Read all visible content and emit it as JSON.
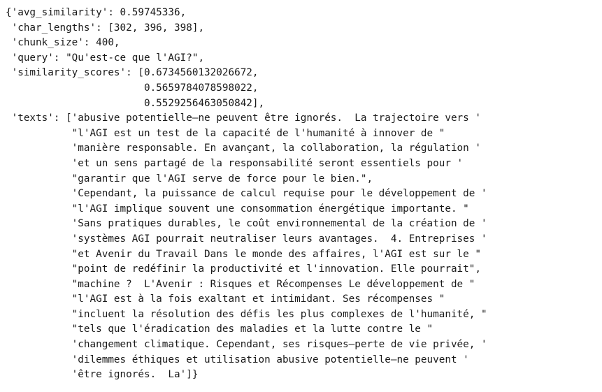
{
  "output": {
    "lines": [
      "{'avg_similarity': 0.59745336,",
      " 'char_lengths': [302, 396, 398],",
      " 'chunk_size': 400,",
      " 'query': \"Qu'est-ce que l'AGI?\",",
      " 'similarity_scores': [0.6734560132026672,",
      "                       0.5659784078598022,",
      "                       0.5529256463050842],",
      " 'texts': ['abusive potentielle—ne peuvent être ignorés.  La trajectoire vers '",
      "           \"l'AGI est un test de la capacité de l'humanité à innover de \"",
      "           'manière responsable. En avançant, la collaboration, la régulation '",
      "           'et un sens partagé de la responsabilité seront essentiels pour '",
      "           \"garantir que l'AGI serve de force pour le bien.\",",
      "           'Cependant, la puissance de calcul requise pour le développement de '",
      "           \"l'AGI implique souvent une consommation énergétique importante. \"",
      "           'Sans pratiques durables, le coût environnemental de la création de '",
      "           'systèmes AGI pourrait neutraliser leurs avantages.  4. Entreprises '",
      "           \"et Avenir du Travail Dans le monde des affaires, l'AGI est sur le \"",
      "           \"point de redéfinir la productivité et l'innovation. Elle pourrait\",",
      "           \"machine ?  L'Avenir : Risques et Récompenses Le développement de \"",
      "           \"l'AGI est à la fois exaltant et intimidant. Ses récompenses \"",
      "           \"incluent la résolution des défis les plus complexes de l'humanité, \"",
      "           \"tels que l'éradication des maladies et la lutte contre le \"",
      "           'changement climatique. Cependant, ses risques—perte de vie privée, '",
      "           'dilemmes éthiques et utilisation abusive potentielle—ne peuvent '",
      "           'être ignorés.  La']}"
    ]
  }
}
